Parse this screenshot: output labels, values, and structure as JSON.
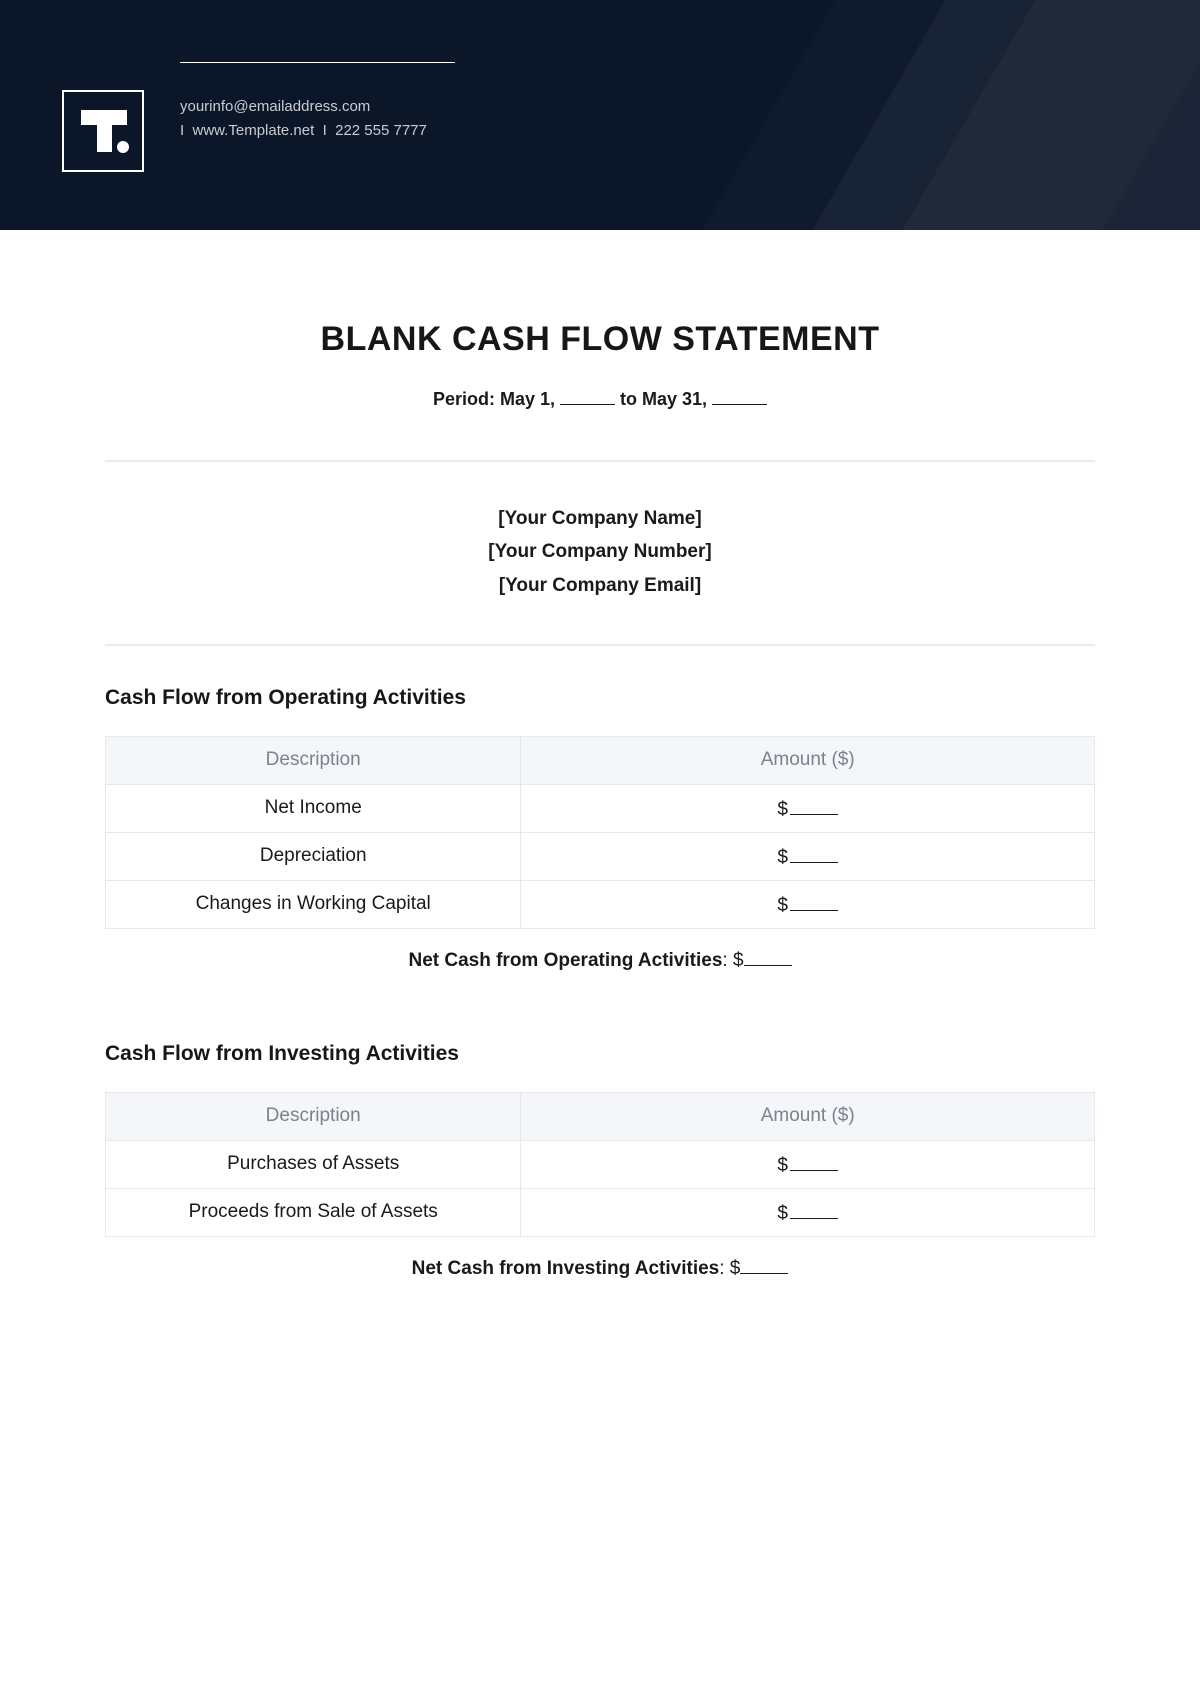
{
  "header": {
    "email": "yourinfo@emailaddress.com",
    "line2_prefix": "I",
    "website": "www.Template.net",
    "separator": "I",
    "phone": "222 555 7777"
  },
  "title": "BLANK CASH FLOW STATEMENT",
  "period": {
    "prefix": "Period: May 1,",
    "middle": "to May 31,"
  },
  "company": {
    "name": "[Your Company Name]",
    "number": "[Your Company Number]",
    "email": "[Your Company Email]"
  },
  "tableHeaders": {
    "desc": "Description",
    "amount": "Amount ($)"
  },
  "operating": {
    "title": "Cash Flow from Operating Activities",
    "rows": [
      {
        "desc": "Net Income",
        "amount": "$"
      },
      {
        "desc": "Depreciation",
        "amount": "$"
      },
      {
        "desc": "Changes in Working Capital",
        "amount": "$"
      }
    ],
    "netLabel": "Net Cash from Operating Activities",
    "netValue": ": $"
  },
  "investing": {
    "title": "Cash Flow from Investing Activities",
    "rows": [
      {
        "desc": "Purchases of Assets",
        "amount": "$"
      },
      {
        "desc": "Proceeds from Sale of Assets",
        "amount": "$"
      }
    ],
    "netLabel": "Net Cash from Investing Activities",
    "netValue": ": $"
  }
}
